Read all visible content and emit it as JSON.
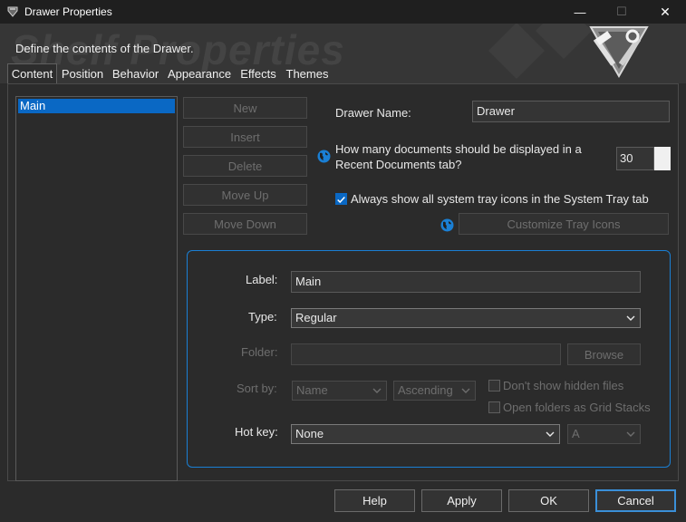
{
  "window": {
    "title": "Drawer Properties",
    "min_glyph": "—",
    "max_glyph": "☐",
    "close_glyph": "✕"
  },
  "banner": {
    "description": "Define the contents of the Drawer.",
    "watermark": "Shelf Properties"
  },
  "tabs": [
    {
      "label": "Content",
      "active": true
    },
    {
      "label": "Position"
    },
    {
      "label": "Behavior"
    },
    {
      "label": "Appearance"
    },
    {
      "label": "Effects"
    },
    {
      "label": "Themes"
    }
  ],
  "drawer_list": {
    "items": [
      "Main"
    ],
    "selected": "Main"
  },
  "list_buttons": {
    "new": "New",
    "insert": "Insert",
    "delete": "Delete",
    "move_up": "Move Up",
    "move_down": "Move Down"
  },
  "drawer_name": {
    "label": "Drawer Name:",
    "value": "Drawer"
  },
  "recent_docs": {
    "label_line1": "How many documents should be displayed in a",
    "label_line2": "Recent Documents tab?",
    "value": "30"
  },
  "tray": {
    "label": "Always show all system tray icons in the System Tray tab",
    "checked": true,
    "customize_label": "Customize Tray Icons"
  },
  "item_group": {
    "label_label": "Label:",
    "label_value": "Main",
    "type_label": "Type:",
    "type_value": "Regular",
    "folder_label": "Folder:",
    "folder_value": "",
    "browse_label": "Browse",
    "sort_label": "Sort by:",
    "sort_field": "Name",
    "sort_order": "Ascending",
    "hidden_files_label": "Don't show hidden files",
    "hidden_files_checked": false,
    "grid_stacks_label": "Open folders as Grid Stacks",
    "grid_stacks_checked": false,
    "hotkey_label": "Hot key:",
    "hotkey_value": "None",
    "hotkey_key": "A"
  },
  "dialog_buttons": {
    "help": "Help",
    "apply": "Apply",
    "ok": "OK",
    "cancel": "Cancel"
  },
  "colors": {
    "accent": "#0a68c4",
    "focus_border": "#1a7fd4",
    "background": "#2b2b2b",
    "titlebar": "#1f1f1f",
    "disabled_text": "#6e6e6e"
  },
  "icons": {
    "app": "shelf-app-icon",
    "globe": "globe-icon",
    "logo": "hammer-wrench-logo",
    "dropdown": "chevron-down-icon"
  }
}
